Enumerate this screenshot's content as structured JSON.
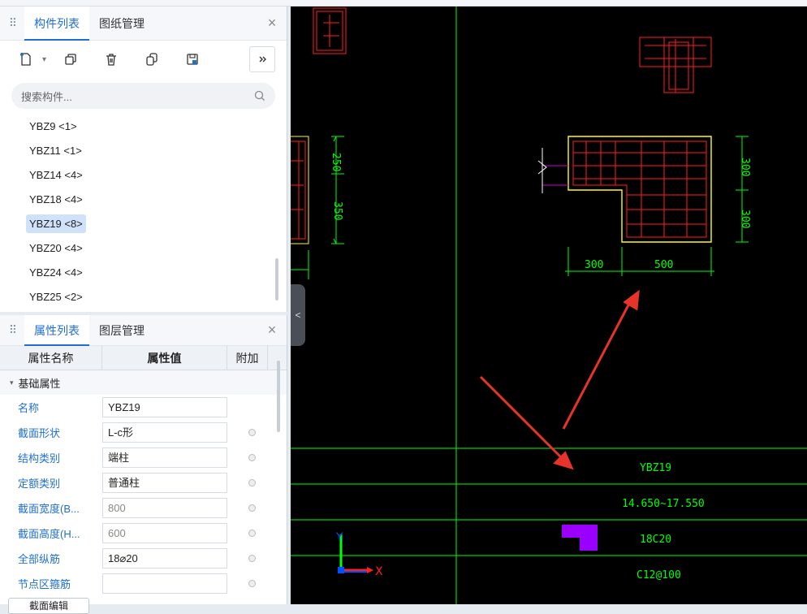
{
  "component_panel": {
    "tabs": [
      "构件列表",
      "图纸管理"
    ],
    "close": "×",
    "search_placeholder": "搜索构件...",
    "items": [
      "YBZ9 <1>",
      "YBZ11 <1>",
      "YBZ14 <4>",
      "YBZ18 <4>",
      "YBZ19 <8>",
      "YBZ20 <4>",
      "YBZ24 <4>",
      "YBZ25 <2>"
    ],
    "selected_index": 4
  },
  "property_panel": {
    "tabs": [
      "属性列表",
      "图层管理"
    ],
    "close": "×",
    "columns": [
      "属性名称",
      "属性值",
      "附加"
    ],
    "group": "基础属性",
    "rows": [
      {
        "name": "名称",
        "value": "YBZ19"
      },
      {
        "name": "截面形状",
        "value": "L-c形"
      },
      {
        "name": "结构类别",
        "value": "端柱"
      },
      {
        "name": "定额类别",
        "value": "普通柱"
      },
      {
        "name": "截面宽度(B...",
        "value": "800"
      },
      {
        "name": "截面高度(H...",
        "value": "600"
      },
      {
        "name": "全部纵筋",
        "value": "18⌀20"
      },
      {
        "name": "节点区箍筋",
        "value": ""
      }
    ],
    "footer_button": "截面编辑"
  },
  "drawing": {
    "dims_left": [
      "250",
      "350"
    ],
    "dims_right": [
      "300",
      "300"
    ],
    "dims_bottom": [
      "300",
      "500"
    ],
    "table": [
      "YBZ19",
      "14.650~17.550",
      "18C20",
      "C12@100"
    ],
    "axis_x": "X",
    "axis_y": "Y"
  },
  "colors": {
    "accent": "#1f6fd1",
    "cad_green": "#00ff00",
    "cad_yellow": "#ffff00",
    "cad_red": "#ff2020",
    "arrow_red": "#e8332b"
  }
}
